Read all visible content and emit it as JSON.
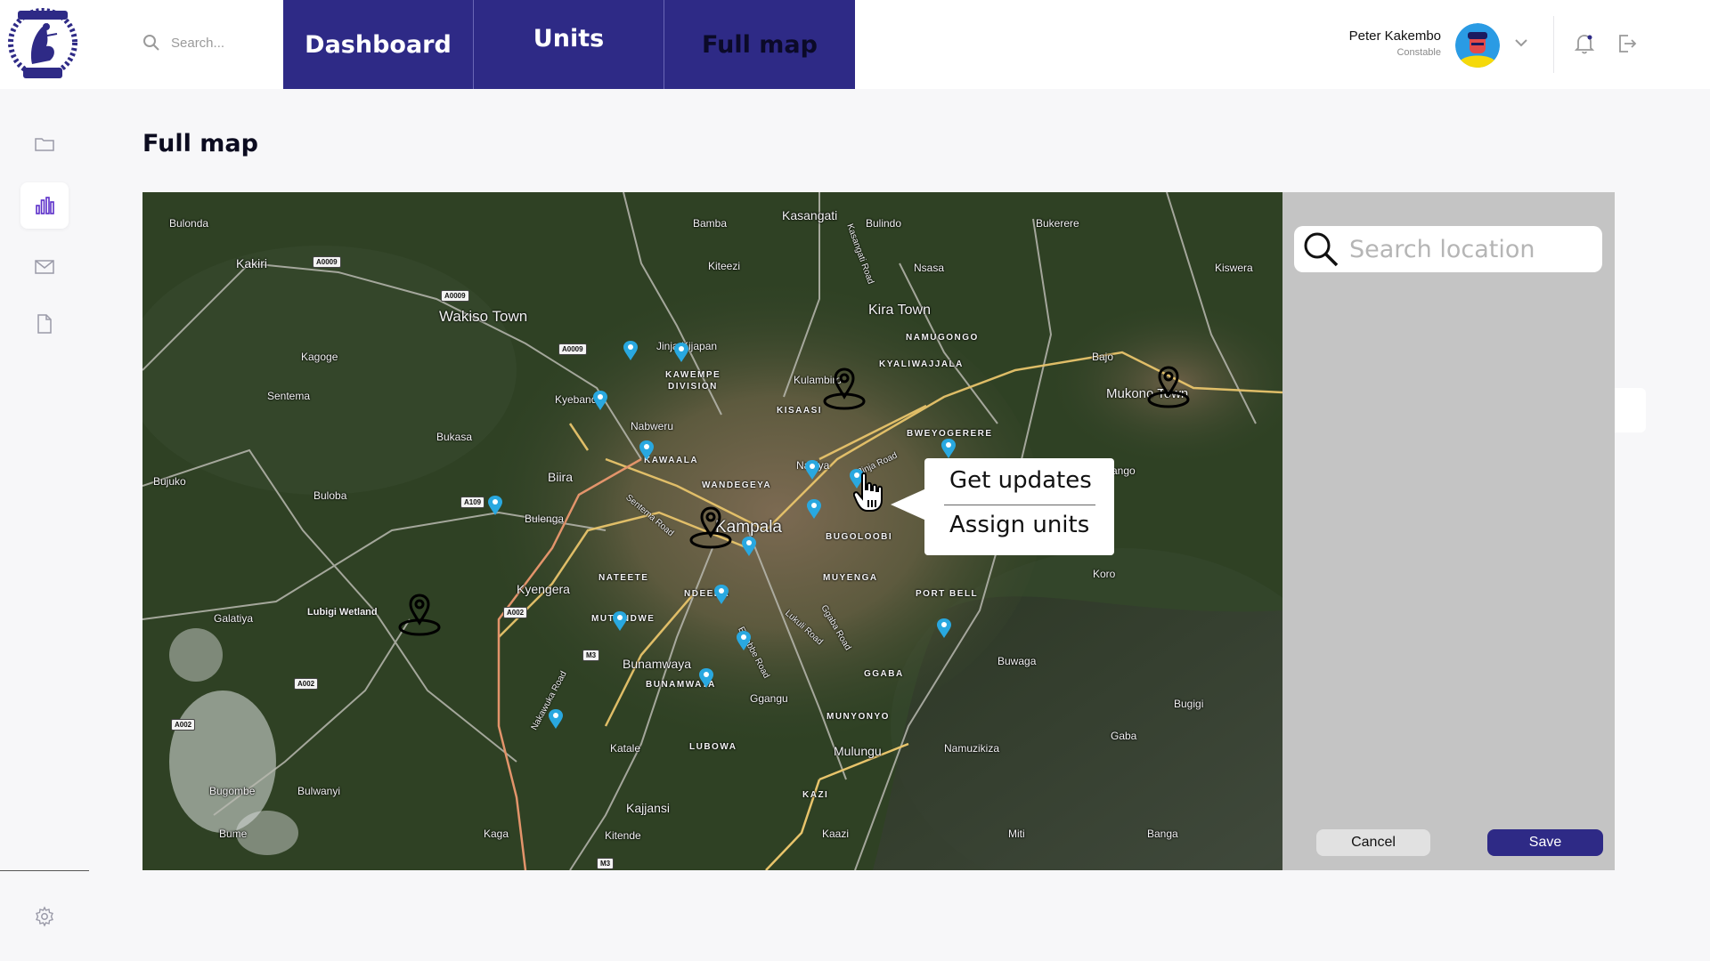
{
  "header": {
    "search_placeholder": "Search...",
    "tabs": [
      {
        "label": "Dashboard"
      },
      {
        "label": "Units"
      },
      {
        "label": "Full map"
      }
    ],
    "user": {
      "name": "Peter Kakembo",
      "role": "Constable"
    }
  },
  "sidebar": {
    "items": [
      "folder-icon",
      "bar-chart-icon",
      "mail-icon",
      "document-icon"
    ],
    "settings": "gear-icon"
  },
  "page": {
    "title": "Full map"
  },
  "map": {
    "labels": {
      "bulonda": "Bulonda",
      "kakiri": "Kakiri",
      "bamba": "Bamba",
      "kasangati": "Kasangati",
      "bulindo": "Bulindo",
      "bukerere": "Bukerere",
      "kiteezi": "Kiteezi",
      "nsasa": "Nsasa",
      "kiswera": "Kiswera",
      "wakiso": "Wakiso Town",
      "kira": "Kira Town",
      "namugongo": "NAMUGONGO",
      "kyaliwajjala": "KYALIWAJJALA",
      "kagoge": "Kagoge",
      "jinja_kijapan": "Jinja Kijapan",
      "kawempe": "KAWEMPE",
      "division": "DIVISION",
      "bajo": "Bajo",
      "mukono": "Mukono Town",
      "sentema": "Sentema",
      "kyebando": "Kyebando",
      "kulambiro": "Kulambiro",
      "kisaasi": "KISAASI",
      "nabweru": "Nabweru",
      "bukasa": "Bukasa",
      "bweyogerere": "BWEYOGERERE",
      "kawaala": "KAWAALA",
      "naalya": "Naalya",
      "bujuko": "Bujuko",
      "biira": "Biira",
      "wandegeya": "WANDEGEYA",
      "buloba": "Buloba",
      "bulenga": "Bulenga",
      "luzira_road": "Jinja Road",
      "ngo": "ango",
      "kampala": "Kampala",
      "bugolobi": "BUGOLOOBI",
      "sentema_road": "Sentema Road",
      "nateete": "NATEETE",
      "ndeeba": "NDEEBA",
      "muyenga": "MUYENGA",
      "koro": "Koro",
      "kyengera": "Kyengera",
      "port_bell": "PORT BELL",
      "galatiya": "Galatiya",
      "lubigi": "Lubigi Wetland",
      "mutundwe": "MUTUNDWE",
      "lukuli_road": "Lukuli Road",
      "ggaba_road": "Ggaba Road",
      "buwaga": "Buwaga",
      "bunamwaya": "Bunamwaya",
      "bunamwaya_caps": "BUNAMWAYA",
      "entebbe_road": "Entebbe Road",
      "ggaba": "GGABA",
      "gangu": "Ggangu",
      "bugiji": "Bugigi",
      "nakawuka_road": "Nakawuka Road",
      "munyonyo": "MUNYONYO",
      "gaba": "Gaba",
      "katale": "Katale",
      "lubowa": "LUBOWA",
      "mulungu": "Mulungu",
      "namuzikiza": "Namuzikiza",
      "bugombe": "Bugombe",
      "bulwanyi": "Bulwanyi",
      "kazi": "KAZI",
      "kajjansi": "Kajjansi",
      "bume": "Bume",
      "kaga": "Kaga",
      "kitende": "Kitende",
      "kaazi": "Kaazi",
      "miti": "Miti",
      "banga": "Banga",
      "kagugu_road": "Kasangati Road"
    },
    "shields": {
      "a0009a": "A0009",
      "a0009b": "A0009",
      "a0009c": "A0009",
      "a109": "A109",
      "a002a": "A002",
      "a002b": "A002",
      "a002c": "A002",
      "m3a": "M3",
      "m3b": "M3"
    },
    "context_menu": {
      "get_updates": "Get updates",
      "assign_units": "Assign units"
    }
  },
  "panel": {
    "search_placeholder": "Search location",
    "cancel_label": "Cancel",
    "save_label": "Save"
  },
  "colors": {
    "brand": "#2e2a86",
    "panel": "#c4c4c4",
    "pin_blue": "#29a8e0"
  }
}
